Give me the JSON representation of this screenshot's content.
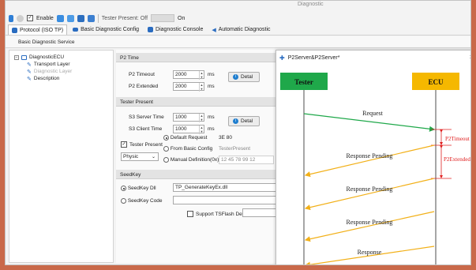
{
  "window_title": "Diagnostic",
  "toolbar": {
    "enable_label": "Enable",
    "tester_present_label": "Tester Present: Off",
    "on_label": "On"
  },
  "tabs": [
    {
      "label": "Protocol (ISO TP)"
    },
    {
      "label": "Basic Diagnostic Config"
    },
    {
      "label": "Diagnostic Console"
    },
    {
      "label": "Automatic Diagnostic"
    }
  ],
  "subtitle": "Basic Diagnostic Service",
  "tree": {
    "root": "DiagnosticECU",
    "children": [
      "Transport Layer",
      "Diagnostic Layer",
      "Description"
    ]
  },
  "p2_time": {
    "header": "P2 Time",
    "timeout_label": "P2 Timeout",
    "timeout_value": "2000",
    "extended_label": "P2 Extended",
    "extended_value": "2000",
    "unit": "ms",
    "detail_label": "Detal"
  },
  "tester_present": {
    "header": "Tester Present",
    "s3_server_label": "S3 Server Time",
    "s3_server_value": "1000",
    "s3_client_label": "S3 Client Time",
    "s3_client_value": "1000",
    "unit": "ms",
    "detail_label": "Detal",
    "checkbox_label": "Tester Present",
    "address_select": "Physic",
    "default_request_label": "Default Request",
    "default_request_value": "3E 80",
    "from_basic_label": "From Basic Config",
    "from_basic_value": "TesterPresent",
    "manual_label": "Manual Definition(0x)",
    "manual_value": "12 45 78 99 12"
  },
  "seedkey": {
    "header": "SeedKey",
    "dll_label": "SeedKey Dll",
    "dll_value": "TP_GenerateKeyEx.dll",
    "code_label": "SeedKey Code",
    "tsflash_label": "Support TSFlash Device"
  },
  "dialog": {
    "title": "P2Server&P2Server*",
    "close": "×",
    "tester_label": "Tester",
    "ecu_label": "ECU",
    "tester_color": "#1fa84a",
    "ecu_color": "#f5b800",
    "p2timeout_label": "P2Timeout",
    "p2extended_label": "P2Extended",
    "messages": [
      "Request",
      "Response Pending",
      "Response Pending",
      "Response Pending",
      "Response"
    ]
  }
}
